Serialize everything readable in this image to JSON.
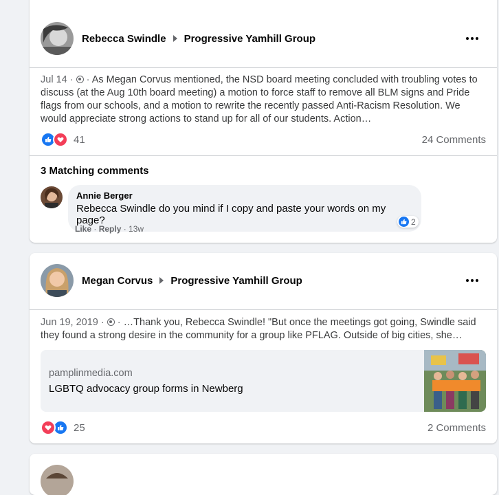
{
  "posts": [
    {
      "author": "Rebecca Swindle",
      "group": "Progressive Yamhill Group",
      "date": "Jul 14 ·",
      "text": "As Megan Corvus mentioned, the NSD board meeting concluded with troubling votes to discuss (at the Aug 10th board meeting) a motion to force staff to remove all BLM signs and Pride flags from our schools, and a motion to rewrite the recently passed Anti-Racism Resolution. We would appreciate strong actions to stand up for all of our students. Action…",
      "reaction_count": "41",
      "comments_count": "24 Comments",
      "matching_title": "3 Matching comments",
      "comment": {
        "author": "Annie Berger",
        "text": "Rebecca Swindle do you mind if I copy and paste your words on my page?",
        "reaction_count": "2",
        "like": "Like",
        "reply": "Reply",
        "time": "13w"
      }
    },
    {
      "author": "Megan Corvus",
      "group": "Progressive Yamhill Group",
      "date": "Jun 19, 2019 ·",
      "text": "…Thank you, Rebecca Swindle! \"But once the meetings got going, Swindle said they found a strong desire in the community for a group like PFLAG. Outside of big cities, she…",
      "link_domain": "pamplinmedia.com",
      "link_title": "LGBTQ advocacy group forms in Newberg",
      "reaction_count": "25",
      "comments_count": "2 Comments"
    }
  ],
  "colors": {
    "like_blue": "#1877f2",
    "love_red": "#f33e58",
    "secondary_text": "#65676b",
    "background": "#f0f2f5"
  },
  "icons": [
    "more-options-icon",
    "triangle-right-icon",
    "globe-icon",
    "like-reaction-icon",
    "love-reaction-icon"
  ]
}
